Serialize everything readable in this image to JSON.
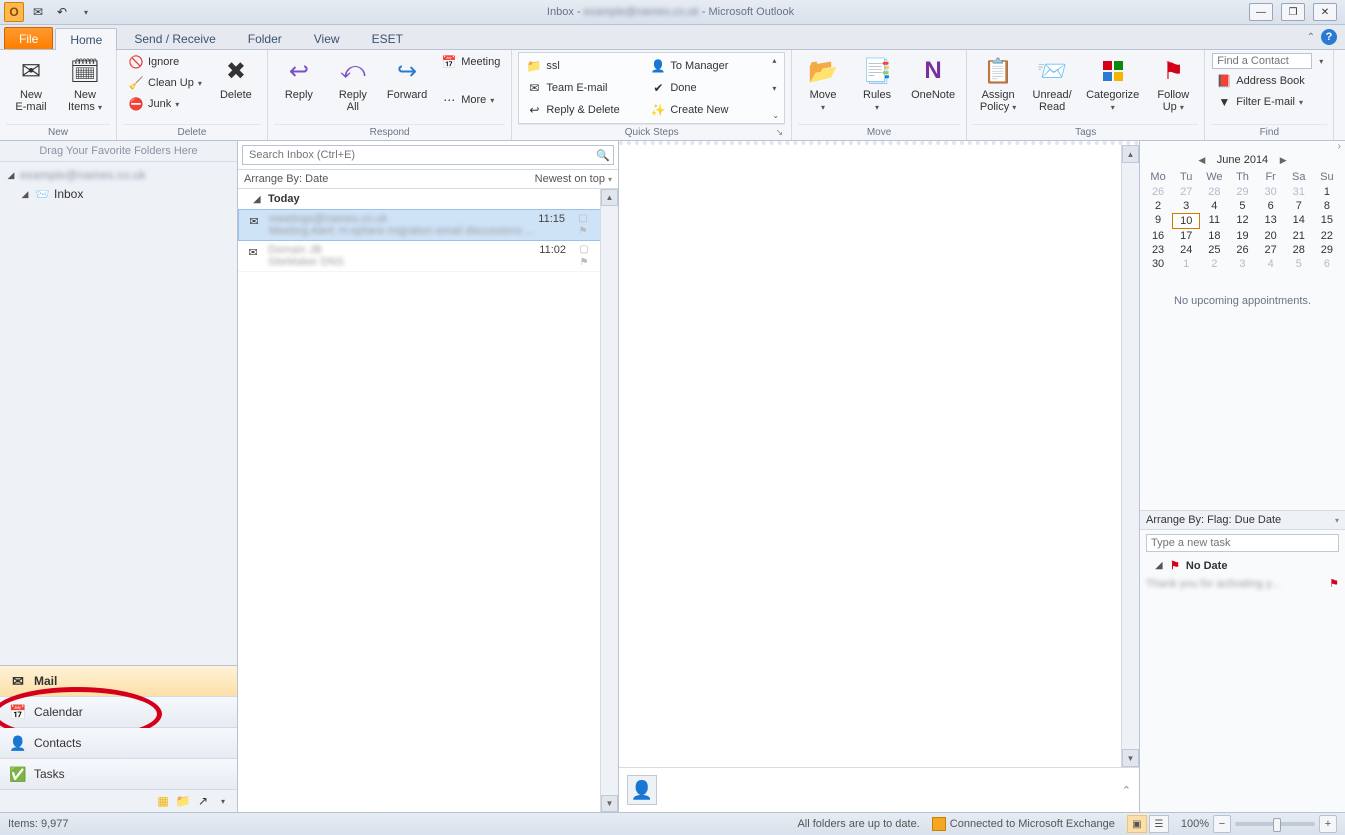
{
  "titlebar": {
    "title_prefix": "Inbox - ",
    "account_blur": "example@names.co.uk",
    "title_suffix": " - Microsoft Outlook"
  },
  "tabs": {
    "file": "File",
    "items": [
      "Home",
      "Send / Receive",
      "Folder",
      "View",
      "ESET"
    ],
    "active": "Home"
  },
  "ribbon": {
    "new": {
      "label": "New",
      "new_email": "New\nE-mail",
      "new_items": "New\nItems"
    },
    "delete": {
      "label": "Delete",
      "ignore": "Ignore",
      "cleanup": "Clean Up",
      "junk": "Junk",
      "delete": "Delete"
    },
    "respond": {
      "label": "Respond",
      "reply": "Reply",
      "reply_all": "Reply\nAll",
      "forward": "Forward",
      "meeting": "Meeting",
      "more": "More"
    },
    "quicksteps": {
      "label": "Quick Steps",
      "col1": [
        "ssl",
        "Team E-mail",
        "Reply & Delete"
      ],
      "col2": [
        "To Manager",
        "Done",
        "Create New"
      ]
    },
    "move": {
      "label": "Move",
      "move": "Move",
      "rules": "Rules",
      "onenote": "OneNote"
    },
    "tags": {
      "label": "Tags",
      "assign": "Assign\nPolicy",
      "unread": "Unread/\nRead",
      "categorize": "Categorize",
      "followup": "Follow\nUp"
    },
    "find": {
      "label": "Find",
      "contact_ph": "Find a Contact",
      "address": "Address Book",
      "filter": "Filter E-mail"
    }
  },
  "nav": {
    "fav_hint": "Drag Your Favorite Folders Here",
    "account_blur": "example@names.co.uk",
    "inbox": "Inbox",
    "buttons": {
      "mail": "Mail",
      "calendar": "Calendar",
      "contacts": "Contacts",
      "tasks": "Tasks"
    }
  },
  "list": {
    "search_ph": "Search Inbox (Ctrl+E)",
    "arrange_by": "Arrange By: Date",
    "sort": "Newest on top",
    "group_today": "Today",
    "items": [
      {
        "from_blur": "meetings@names.co.uk",
        "time": "11:15",
        "subj_blur": "Meeting Alert: H-sphere migration email discussions ...",
        "selected": true
      },
      {
        "from_blur": "Domain JB",
        "time": "11:02",
        "subj_blur": "SiteMaker DNS",
        "selected": false
      }
    ]
  },
  "todo": {
    "month": "June 2014",
    "dow": [
      "Mo",
      "Tu",
      "We",
      "Th",
      "Fr",
      "Sa",
      "Su"
    ],
    "weeks": [
      [
        {
          "d": 26,
          "o": true
        },
        {
          "d": 27,
          "o": true
        },
        {
          "d": 28,
          "o": true
        },
        {
          "d": 29,
          "o": true
        },
        {
          "d": 30,
          "o": true
        },
        {
          "d": 31,
          "o": true
        },
        {
          "d": 1
        }
      ],
      [
        {
          "d": 2
        },
        {
          "d": 3
        },
        {
          "d": 4
        },
        {
          "d": 5
        },
        {
          "d": 6
        },
        {
          "d": 7
        },
        {
          "d": 8
        }
      ],
      [
        {
          "d": 9
        },
        {
          "d": 10,
          "today": true
        },
        {
          "d": 11
        },
        {
          "d": 12
        },
        {
          "d": 13
        },
        {
          "d": 14
        },
        {
          "d": 15
        }
      ],
      [
        {
          "d": 16
        },
        {
          "d": 17
        },
        {
          "d": 18
        },
        {
          "d": 19
        },
        {
          "d": 20
        },
        {
          "d": 21
        },
        {
          "d": 22
        }
      ],
      [
        {
          "d": 23
        },
        {
          "d": 24
        },
        {
          "d": 25
        },
        {
          "d": 26
        },
        {
          "d": 27
        },
        {
          "d": 28
        },
        {
          "d": 29
        }
      ],
      [
        {
          "d": 30
        },
        {
          "d": 1,
          "o": true
        },
        {
          "d": 2,
          "o": true
        },
        {
          "d": 3,
          "o": true
        },
        {
          "d": 4,
          "o": true
        },
        {
          "d": 5,
          "o": true
        },
        {
          "d": 6,
          "o": true
        }
      ]
    ],
    "no_appt": "No upcoming appointments.",
    "task_arrange": "Arrange By: Flag: Due Date",
    "task_ph": "Type a new task",
    "no_date": "No Date",
    "task_blur": "Thank you for activating y..."
  },
  "status": {
    "items": "Items: 9,977",
    "uptodate": "All folders are up to date.",
    "connected": "Connected to Microsoft Exchange",
    "zoom": "100%"
  }
}
